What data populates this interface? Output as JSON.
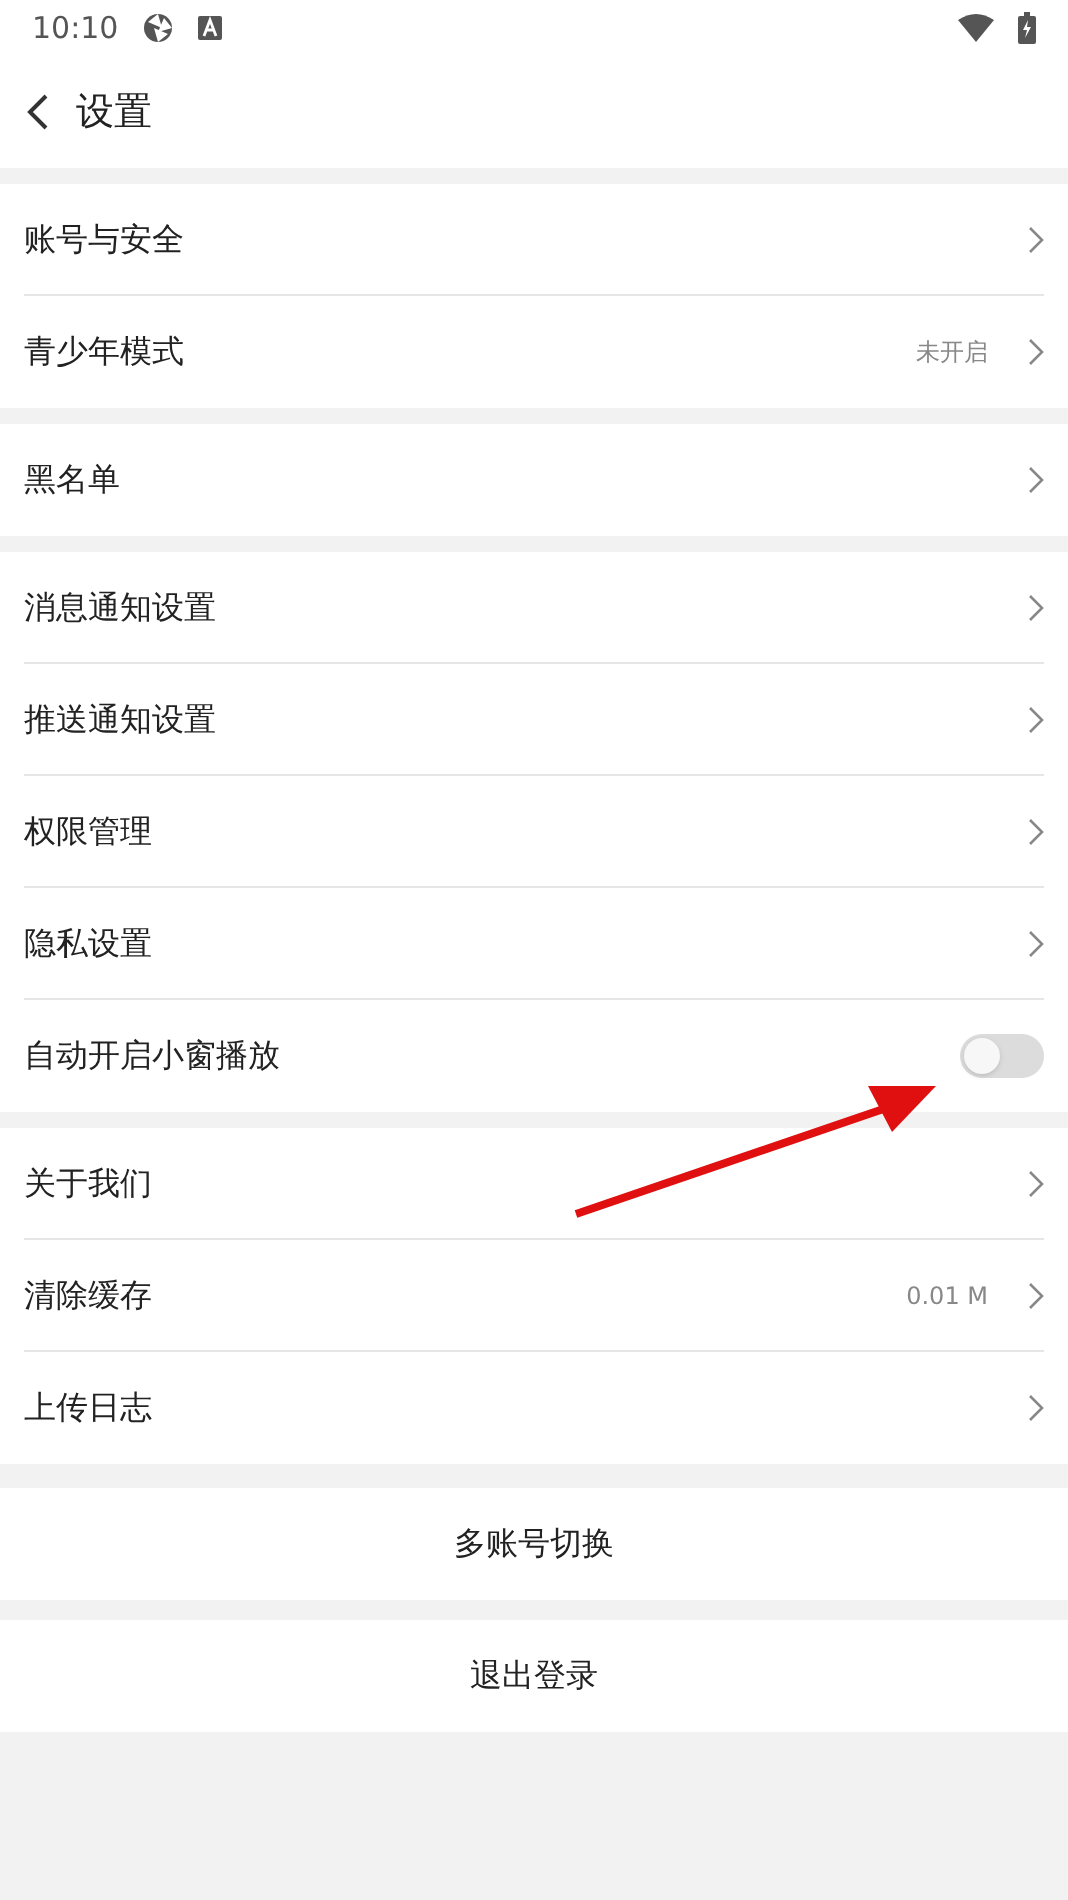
{
  "status_bar": {
    "time": "10:10"
  },
  "header": {
    "title": "设置"
  },
  "sections": [
    {
      "items": [
        {
          "kind": "link",
          "label": "账号与安全"
        },
        {
          "kind": "link",
          "label": "青少年模式",
          "value": "未开启"
        }
      ]
    },
    {
      "items": [
        {
          "kind": "link",
          "label": "黑名单"
        }
      ]
    },
    {
      "items": [
        {
          "kind": "link",
          "label": "消息通知设置"
        },
        {
          "kind": "link",
          "label": "推送通知设置"
        },
        {
          "kind": "link",
          "label": "权限管理"
        },
        {
          "kind": "link",
          "label": "隐私设置"
        },
        {
          "kind": "toggle",
          "label": "自动开启小窗播放",
          "on": false
        }
      ]
    },
    {
      "items": [
        {
          "kind": "link",
          "label": "关于我们"
        },
        {
          "kind": "link",
          "label": "清除缓存",
          "value": "0.01 M"
        },
        {
          "kind": "link",
          "label": "上传日志"
        }
      ]
    }
  ],
  "buttons": [
    "多账号切换",
    "退出登录"
  ]
}
